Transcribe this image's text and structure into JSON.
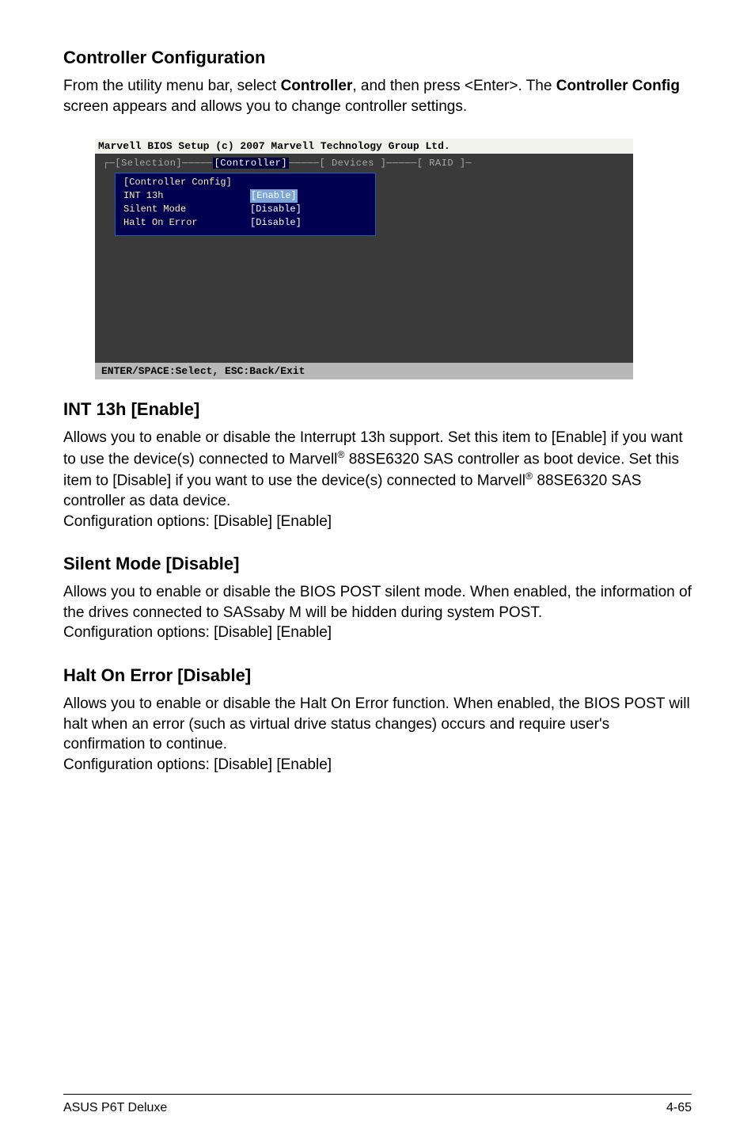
{
  "sections": [
    {
      "heading": "Controller Configuration",
      "para_pre": "From the utility menu bar, select ",
      "para_bold1": "Controller",
      "para_mid": ", and then press <Enter>. The ",
      "para_bold2": "Controller Config",
      "para_post": " screen appears and allows you to change controller settings."
    },
    {
      "heading": "INT 13h [Enable]",
      "body_pre": "Allows you to enable or disable the Interrupt 13h support. Set this item to [Enable] if you want to use the device(s) connected to Marvell",
      "body_mid": " 88SE6320 SAS controller as boot device. Set this item to [Disable] if you want to use the device(s) connected to Marvell",
      "body_post": " 88SE6320 SAS controller as data device.",
      "config": "Configuration options: [Disable] [Enable]"
    },
    {
      "heading": "Silent Mode [Disable]",
      "body": "Allows you to enable or disable the BIOS POST silent mode. When enabled, the information of the drives connected to SASsaby M will be hidden during system POST.",
      "config": "Configuration options: [Disable] [Enable]"
    },
    {
      "heading": "Halt On Error [Disable]",
      "body": "Allows you to enable or disable the Halt On Error function. When enabled, the BIOS POST will halt when an error (such as virtual drive status changes) occurs and require user's confirmation to continue.",
      "config": "Configuration options: [Disable] [Enable]"
    }
  ],
  "bios": {
    "title": "Marvell BIOS Setup (c) 2007 Marvell Technology Group Ltd.",
    "tabs": {
      "t1": "[Selection]",
      "t2": "[Controller]",
      "t3": "[ Devices ]",
      "t4": "[  RAID  ]"
    },
    "popup": {
      "title": "[Controller Config]",
      "rows": [
        {
          "label": "INT 13h",
          "value": "[Enable]",
          "highlight": true
        },
        {
          "label": "Silent Mode",
          "value": "[Disable]",
          "highlight": false
        },
        {
          "label": "Halt On Error",
          "value": "[Disable]",
          "highlight": false
        }
      ]
    },
    "footer": "ENTER/SPACE:Select, ESC:Back/Exit"
  },
  "footer": {
    "left": "ASUS P6T Deluxe",
    "right": "4-65"
  },
  "reg": "®"
}
